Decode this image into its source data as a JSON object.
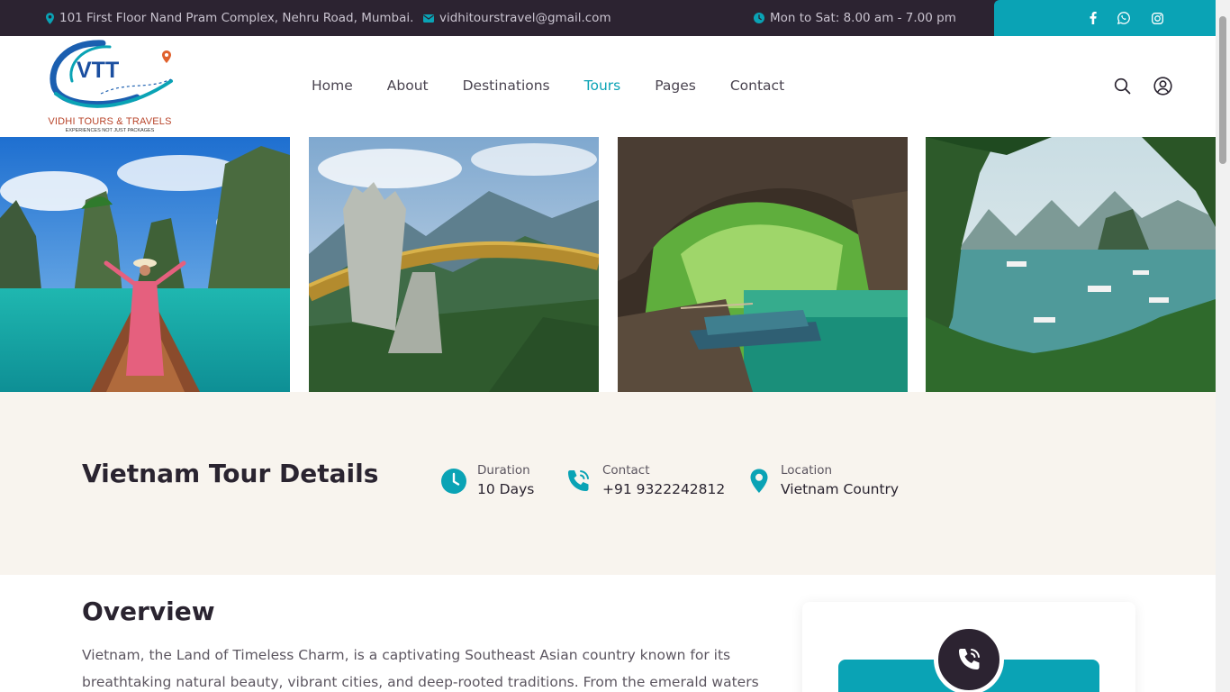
{
  "topbar": {
    "address": "101 First Floor Nand Pram Complex, Nehru Road, Mumbai.",
    "email": "vidhitourstravel@gmail.com",
    "hours": "Mon to Sat: 8.00 am - 7.00 pm",
    "social_icons": [
      "facebook-icon",
      "whatsapp-icon",
      "instagram-icon"
    ]
  },
  "logo": {
    "mark": "VTT",
    "name": "VIDHI TOURS & TRAVELS",
    "tagline": "EXPERIENCES NOT JUST PACKAGES"
  },
  "nav": {
    "items": [
      "Home",
      "About",
      "Destinations",
      "Tours",
      "Pages",
      "Contact"
    ],
    "active": "Tours"
  },
  "header_icons": [
    "search-icon",
    "user-icon"
  ],
  "gallery": {
    "photos": [
      "limestone-karst-lake-boat",
      "golden-bridge-hands",
      "cave-river-boats",
      "bay-islands-cruise-boats"
    ]
  },
  "details": {
    "title": "Vietnam Tour Details",
    "duration": {
      "label": "Duration",
      "value": "10 Days"
    },
    "contact": {
      "label": "Contact",
      "value": "+91 9322242812"
    },
    "location": {
      "label": "Location",
      "value": "Vietnam Country"
    }
  },
  "overview": {
    "title": "Overview",
    "text": "Vietnam, the Land of Timeless Charm, is a captivating Southeast Asian country known for its breathtaking natural beauty, vibrant cities, and deep-rooted traditions. From the emerald waters of"
  },
  "colors": {
    "accent": "#0aa3b5",
    "dark": "#2c2331",
    "band_bg": "#f8f4ee"
  }
}
